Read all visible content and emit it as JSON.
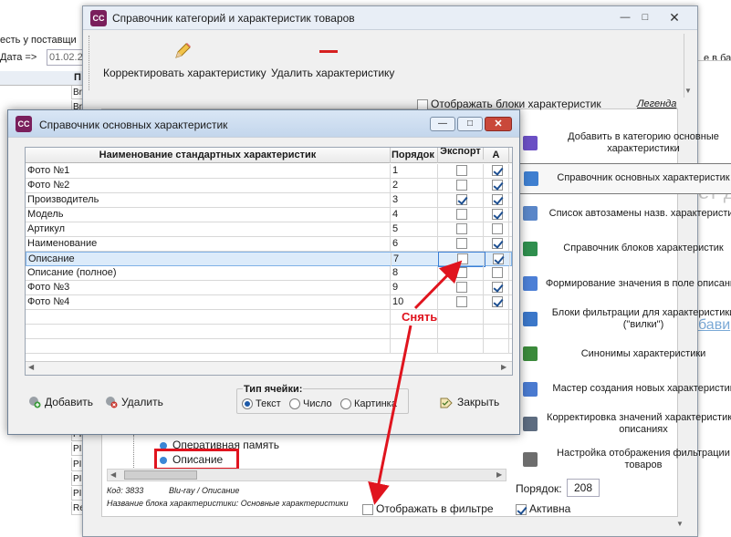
{
  "background": {
    "left_text_1": "есть у поставщи",
    "date_label": "Дата =>",
    "date_value": "01.02.2",
    "col_header": "П",
    "col_cells": [
      "Br",
      "Br",
      "Br",
      "Br",
      "",
      "",
      "",
      "",
      "",
      "",
      "",
      "",
      "",
      "",
      "",
      "",
      "",
      "",
      "",
      "",
      "",
      "PI",
      "PI",
      "PI",
      "PI",
      "PI",
      "PI",
      "PI",
      "Re"
    ],
    "right_text_1": "е в баз",
    "right_text_2": "ет д",
    "right_link": "бави"
  },
  "main_window": {
    "title": "Справочник категорий и характеристик товаров",
    "icon_label": "СС",
    "toolbar": {
      "edit_label": "Корректировать характеристику",
      "delete_label": "Удалить характеристику"
    },
    "show_blocks_label": "Отображать блоки характеристик",
    "legend_label": "Легенда",
    "nav_items": [
      {
        "label": "Добавить в категорию основные характеристики",
        "icon": "puzzle-icon",
        "color": "#6b4fc4"
      },
      {
        "label": "Справочник основных характеристик",
        "icon": "edit-list-icon",
        "color": "#3f7fd0"
      },
      {
        "label": "Список автозамены назв. характеристик",
        "icon": "replace-list-icon",
        "color": "#5a86c8"
      },
      {
        "label": "Справочник блоков характеристик",
        "icon": "blocks-icon",
        "color": "#2f8f4e"
      },
      {
        "label": "Формирование значения в поле описание",
        "icon": "formula-icon",
        "color": "#4c7fd6"
      },
      {
        "label": "Блоки фильтрации для характеристики (\"вилки\")",
        "icon": "filter-blocks-icon",
        "color": "#3b77c9"
      },
      {
        "label": "Синонимы характеристики",
        "icon": "tree-icon",
        "color": "#3b8a3b"
      },
      {
        "label": "Мастер создания новых характеристик",
        "icon": "wizard-icon",
        "color": "#4a7ad0"
      },
      {
        "label": "Корректировка значений характеристик в описаниях",
        "icon": "correct-icon",
        "color": "#5d6c80"
      },
      {
        "label": "Настройка отображения фильтрации товаров",
        "icon": "settings-filter-icon",
        "color": "#6d6d6d"
      }
    ],
    "tree_items": [
      "Оперативная память",
      "Описание"
    ],
    "code_line": "Код: 3833",
    "path_line": "Blu-ray / Описание",
    "block_name_line": "Название блока характеристики: Основные характеристики",
    "show_in_filter_label": "Отображать в фильтре",
    "order_label": "Порядок:",
    "order_value": "208",
    "active_label": "Активна"
  },
  "dialog": {
    "title": "Справочник основных характеристик",
    "icon_label": "СС",
    "columns": [
      "Наименование стандартных характеристик",
      "Порядок",
      "Экспорт",
      "А"
    ],
    "rows": [
      {
        "name": "Фото №1",
        "order": "1",
        "export": false,
        "a": true
      },
      {
        "name": "Фото №2",
        "order": "2",
        "export": false,
        "a": true
      },
      {
        "name": "Производитель",
        "order": "3",
        "export": true,
        "a": true
      },
      {
        "name": "Модель",
        "order": "4",
        "export": false,
        "a": true
      },
      {
        "name": "Артикул",
        "order": "5",
        "export": false,
        "a": false
      },
      {
        "name": "Наименование",
        "order": "6",
        "export": false,
        "a": true
      },
      {
        "name": "Описание",
        "order": "7",
        "export": false,
        "a": true,
        "selected": true
      },
      {
        "name": "Описание (полное)",
        "order": "8",
        "export": false,
        "a": false
      },
      {
        "name": "Фото №3",
        "order": "9",
        "export": false,
        "a": true
      },
      {
        "name": "Фото №4",
        "order": "10",
        "export": false,
        "a": true
      }
    ],
    "add_label": "Добавить",
    "delete_label": "Удалить",
    "cell_type_label": "Тип ячейки:",
    "cell_types": [
      "Текст",
      "Число",
      "Картинка"
    ],
    "cell_type_selected": "Текст",
    "close_label": "Закрыть"
  },
  "annotation": {
    "text": "Снять",
    "color": "#e0141e"
  }
}
